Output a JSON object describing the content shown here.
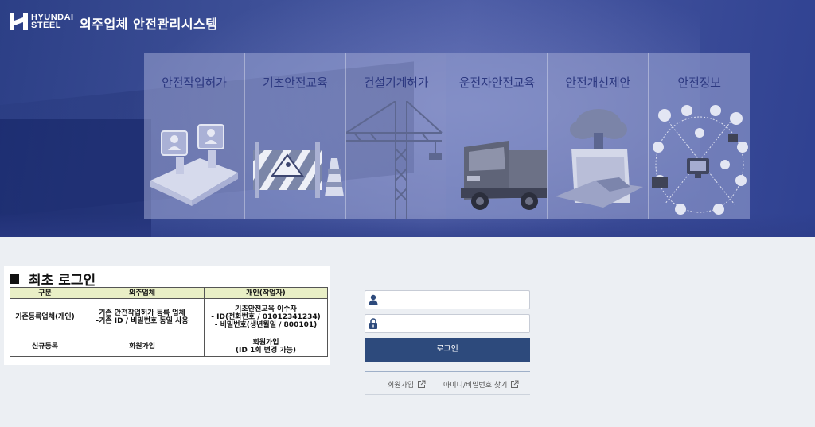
{
  "header": {
    "logo_line1": "HYUNDAI",
    "logo_line2": "STEEL",
    "system_title": "외주업체 안전관리시스템"
  },
  "menu": [
    {
      "label": "안전작업허가",
      "icon": "meeting-chat-icon"
    },
    {
      "label": "기초안전교육",
      "icon": "construction-barrier-icon"
    },
    {
      "label": "건설기계허가",
      "icon": "tower-crane-icon"
    },
    {
      "label": "운전자안전교육",
      "icon": "truck-icon"
    },
    {
      "label": "안전개선제안",
      "icon": "cloud-upload-icon"
    },
    {
      "label": "안전정보",
      "icon": "network-devices-icon"
    }
  ],
  "guide": {
    "title": "최초 로그인",
    "headers": [
      "구분",
      "외주업체",
      "개인(작업자)"
    ],
    "rows": [
      {
        "type": "기존등록업체(개인)",
        "company_line1": "기존 안전작업허가 등록 업체",
        "company_line2": "-기존 ID / 비밀번호 동일 사용",
        "person_line1": "기초안전교육 이수자",
        "person_line2": "- ID(전화번호 / 01012341234)",
        "person_line3": "- 비밀번호(생년월일 / 800101)"
      },
      {
        "type": "신규등록",
        "company_line1": "회원가입",
        "person_line1": "회원가입",
        "person_line2": "(ID 1회 변경 가능)"
      }
    ]
  },
  "login": {
    "id_value": "",
    "pw_value": "",
    "button_label": "로그인",
    "signup_link": "회원가입",
    "find_link": "아이디/비밀번호 찾기"
  },
  "colors": {
    "hero": "#3d4f97",
    "tile_text": "#2c3880",
    "login_button": "#2d4a7c",
    "table_header": "#e9efc6"
  }
}
